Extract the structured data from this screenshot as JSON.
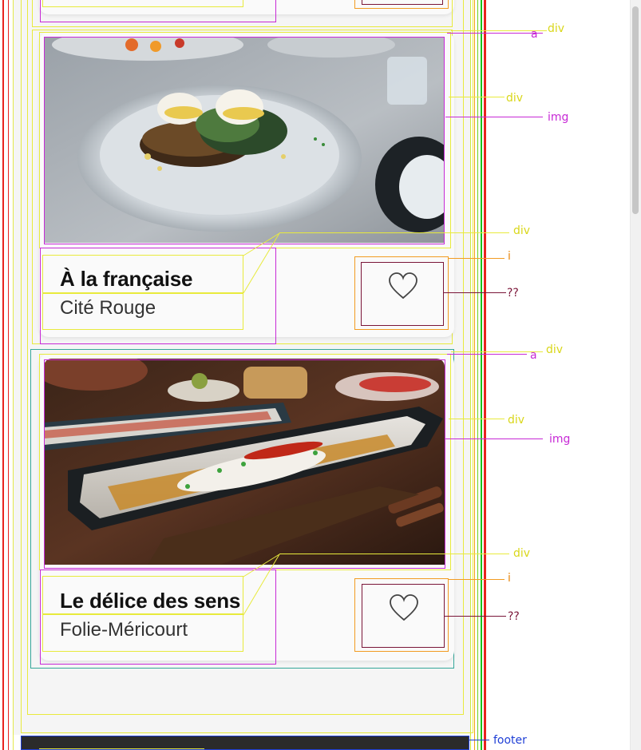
{
  "cards": [
    {
      "title": "À la française",
      "subtitle": "Cité Rouge",
      "favorite_icon": "heart-outline-icon"
    },
    {
      "title": "Le délice des sens",
      "subtitle": "Folie-Méricourt",
      "favorite_icon": "heart-outline-icon"
    }
  ],
  "debug_labels": {
    "a": "a",
    "div": "div",
    "img": "img",
    "i": "i",
    "unknown": "??",
    "footer": "footer"
  },
  "colors": {
    "page_bg": "#f5f5f5",
    "card_bg": "#fafafa",
    "footer_bg": "#2b2b2b",
    "outline_div": "#e8ea3c",
    "outline_img": "#c729d6",
    "outline_i": "#f29b22",
    "outline_unknown": "#7a1538",
    "outline_footer": "#1f3fd6",
    "rail_red": "#e8231e"
  }
}
